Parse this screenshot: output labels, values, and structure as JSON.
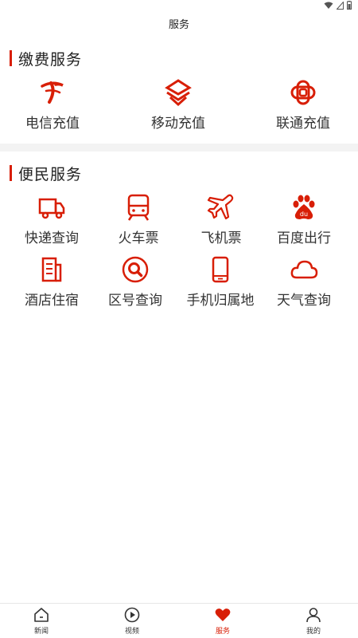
{
  "header": {
    "title": "服务"
  },
  "colors": {
    "accent": "#d81e06",
    "divider": "#f3f3f3"
  },
  "payment_section": {
    "title": "缴费服务",
    "items": [
      {
        "label": "电信充值",
        "icon": "china-telecom-icon"
      },
      {
        "label": "移动充值",
        "icon": "china-mobile-icon"
      },
      {
        "label": "联通充值",
        "icon": "china-unicom-icon"
      }
    ]
  },
  "convenience_section": {
    "title": "便民服务",
    "items": [
      {
        "label": "快递查询",
        "icon": "truck-icon"
      },
      {
        "label": "火车票",
        "icon": "train-icon"
      },
      {
        "label": "飞机票",
        "icon": "airplane-icon"
      },
      {
        "label": "百度出行",
        "icon": "baidu-paw-icon"
      },
      {
        "label": "酒店住宿",
        "icon": "building-icon"
      },
      {
        "label": "区号查询",
        "icon": "search-circle-icon"
      },
      {
        "label": "手机归属地",
        "icon": "phone-icon"
      },
      {
        "label": "天气查询",
        "icon": "cloud-icon"
      }
    ]
  },
  "bottom_nav": {
    "items": [
      {
        "label": "新闻",
        "icon": "home-icon",
        "active": false
      },
      {
        "label": "视频",
        "icon": "play-icon",
        "active": false
      },
      {
        "label": "服务",
        "icon": "heart-icon",
        "active": true
      },
      {
        "label": "我的",
        "icon": "user-icon",
        "active": false
      }
    ]
  }
}
